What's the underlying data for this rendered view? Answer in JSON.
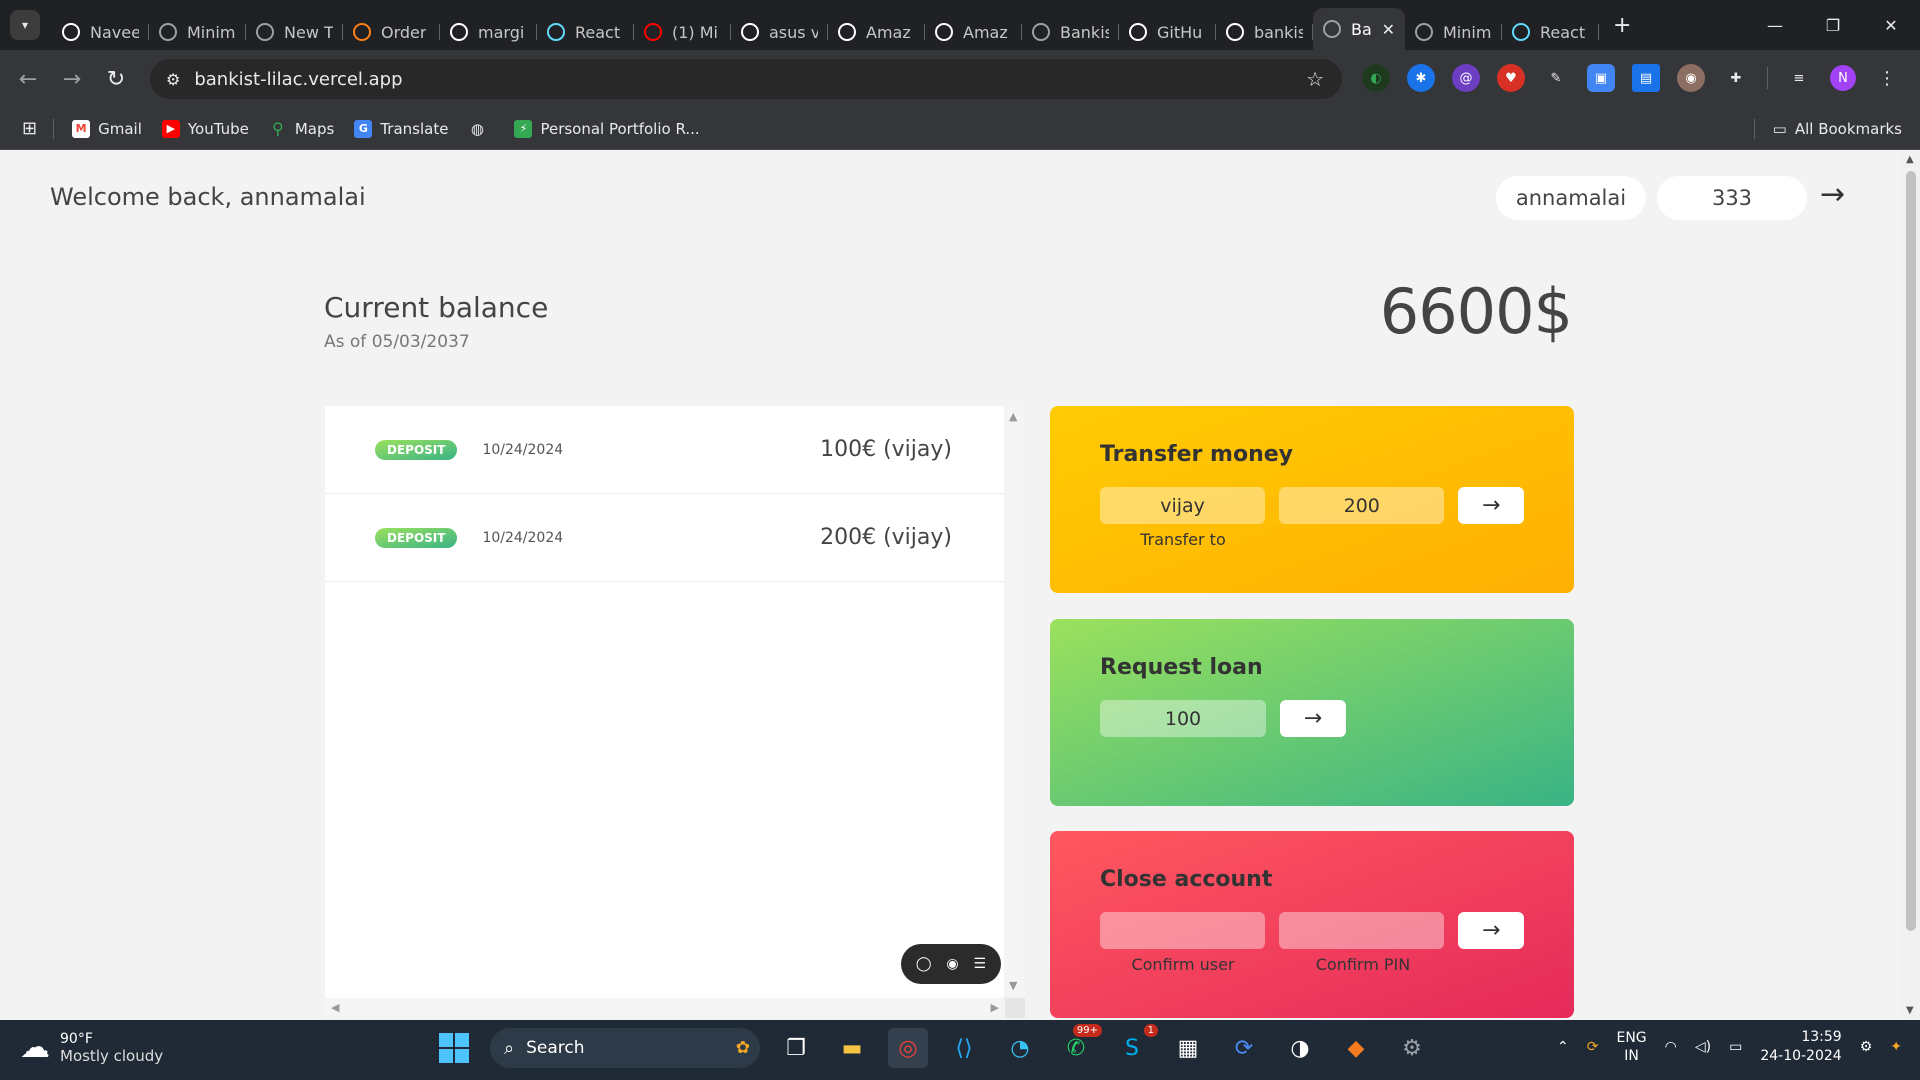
{
  "browser": {
    "tabs": [
      {
        "label": "Navee",
        "icon": "github-icon",
        "color": "#ffffff"
      },
      {
        "label": "Minim",
        "icon": "globe-icon",
        "color": "#9aa0a6"
      },
      {
        "label": "New T",
        "icon": "chrome-icon",
        "color": "#9aa0a6"
      },
      {
        "label": "Order",
        "icon": "swiggy-icon",
        "color": "#fc8019"
      },
      {
        "label": "margi",
        "icon": "google-icon",
        "color": "#ffffff"
      },
      {
        "label": "React",
        "icon": "react-icon",
        "color": "#61dafb"
      },
      {
        "label": "(1) Mi",
        "icon": "youtube-icon",
        "color": "#ff0000"
      },
      {
        "label": "asus v",
        "icon": "google-icon",
        "color": "#ffffff"
      },
      {
        "label": "Amaz",
        "icon": "amazon-icon",
        "color": "#ffffff"
      },
      {
        "label": "Amaz",
        "icon": "amazon-icon",
        "color": "#ffffff"
      },
      {
        "label": "Bankis",
        "icon": "globe-icon",
        "color": "#9aa0a6"
      },
      {
        "label": "GitHu",
        "icon": "github-icon",
        "color": "#ffffff"
      },
      {
        "label": "bankis",
        "icon": "vercel-icon",
        "color": "#ffffff"
      },
      {
        "label": "Ba",
        "icon": "globe-icon",
        "color": "#9aa0a6",
        "active": true
      },
      {
        "label": "Minim",
        "icon": "globe-icon",
        "color": "#9aa0a6"
      },
      {
        "label": "React",
        "icon": "react-icon",
        "color": "#61dafb"
      }
    ],
    "url": "bankist-lilac.vercel.app",
    "bookmarks": [
      "Gmail",
      "YouTube",
      "Maps",
      "Translate",
      "",
      "Personal Portfolio R..."
    ],
    "all_bookmarks": "All Bookmarks",
    "profile_initial": "N"
  },
  "app": {
    "welcome": "Welcome back, annamalai",
    "login_user": "annamalai",
    "login_pin": "333",
    "arrow": "→",
    "balance_label": "Current balance",
    "balance_date_prefix": "As of",
    "balance_date": "05/03/2037",
    "balance_value": "6600$",
    "movements": [
      {
        "type": "deposit",
        "date": "10/24/2024",
        "value": "100€ (vijay)"
      },
      {
        "type": "deposit",
        "date": "10/24/2024",
        "value": "200€ (vijay)"
      }
    ],
    "transfer": {
      "title": "Transfer money",
      "to": "vijay",
      "amount": "200",
      "label_to": "Transfer to",
      "color": "#ffbb03"
    },
    "loan": {
      "title": "Request loan",
      "amount": "100",
      "color": "#6cd070"
    },
    "close": {
      "title": "Close account",
      "user": "",
      "pin": "",
      "label_user": "Confirm user",
      "label_pin": "Confirm PIN",
      "color": "#f5405c"
    }
  },
  "taskbar": {
    "weather_temp": "90°F",
    "weather_desc": "Mostly cloudy",
    "search": "Search",
    "whatsapp_badge": "99+",
    "skype_badge": "1",
    "lang": "ENG",
    "region": "IN",
    "time": "13:59",
    "date": "24-10-2024"
  }
}
